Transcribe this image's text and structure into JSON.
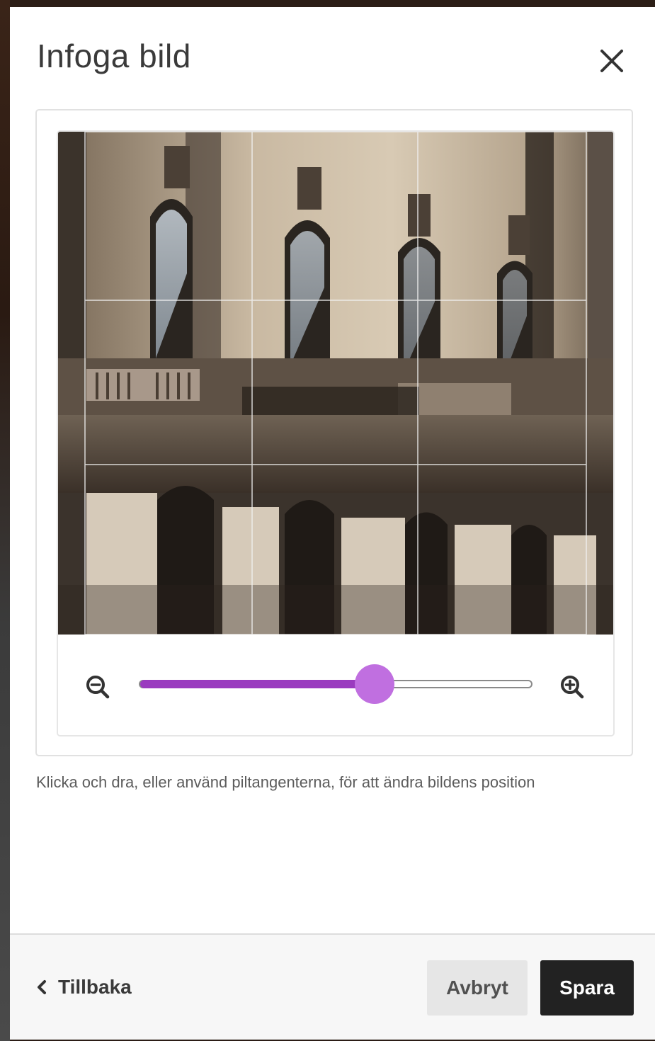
{
  "dialog": {
    "title": "Infoga bild",
    "close_icon": "close-icon"
  },
  "cropper": {
    "image_subject": "building-facade-photo",
    "zoom": {
      "zoom_out_icon": "zoom-out-icon",
      "zoom_in_icon": "zoom-in-icon",
      "level_fraction": 0.6,
      "accent_color": "#9a3bbf",
      "thumb_color": "#c06fe0"
    }
  },
  "hint": "Klicka och dra, eller använd piltangenterna, för att ändra bildens position",
  "footer": {
    "back_label": "Tillbaka",
    "back_icon": "chevron-left-icon",
    "cancel_label": "Avbryt",
    "save_label": "Spara"
  }
}
